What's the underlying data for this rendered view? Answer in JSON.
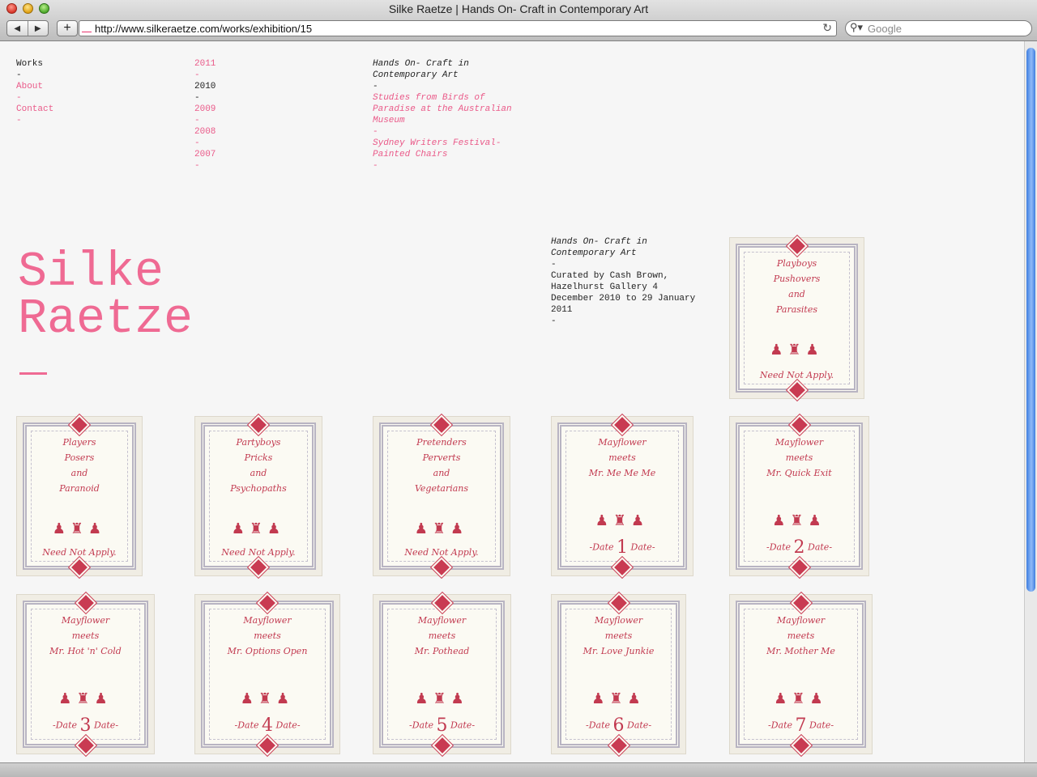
{
  "browser": {
    "title": "Silke Raetze | Hands On- Craft in Contemporary Art",
    "url": "http://www.silkeraetze.com/works/exhibition/15",
    "search_placeholder": "Google"
  },
  "nav": {
    "items": [
      {
        "label": "Works",
        "sep": "-"
      },
      {
        "label": "About",
        "sep": "-"
      },
      {
        "label": "Contact",
        "sep": "-"
      }
    ]
  },
  "years": {
    "items": [
      {
        "label": "2011",
        "sep": "-"
      },
      {
        "label": "2010",
        "sep": "-"
      },
      {
        "label": "2009",
        "sep": "-"
      },
      {
        "label": "2008",
        "sep": "-"
      },
      {
        "label": "2007",
        "sep": "-"
      }
    ]
  },
  "exhibitions": {
    "current": {
      "line1": "Hands On- Craft in",
      "line2": "Contemporary Art",
      "sep": "-"
    },
    "items": [
      {
        "lines": [
          "Studies from Birds of",
          "Paradise at the Australian",
          "Museum"
        ],
        "sep": "-"
      },
      {
        "lines": [
          "Sydney Writers Festival-",
          "Painted Chairs"
        ],
        "sep": "-"
      }
    ]
  },
  "logo": {
    "line1": "Silke",
    "line2": "Raetze"
  },
  "exhibition_info": {
    "title_line1": "Hands On- Craft in",
    "title_line2": "Contemporary Art",
    "sep1": "-",
    "desc": [
      "Curated by Cash Brown,",
      "Hazelhurst Gallery 4",
      "December 2010 to 29 January",
      "2011"
    ],
    "sep2": "-"
  },
  "colors": {
    "accent": "#ea5a89",
    "thread": "#c23a50",
    "text": "#222222"
  },
  "artworks": [
    {
      "lines": [
        "Playboys",
        "Pushovers",
        "and",
        "Parasites"
      ],
      "foot": "Need Not Apply."
    },
    {
      "lines": [
        "Players",
        "Posers",
        "and",
        "Paranoid"
      ],
      "foot": "Need Not Apply."
    },
    {
      "lines": [
        "Partyboys",
        "Pricks",
        "and",
        "Psychopaths"
      ],
      "foot": "Need Not Apply."
    },
    {
      "lines": [
        "Pretenders",
        "Perverts",
        "and",
        "Vegetarians"
      ],
      "foot": "Need Not Apply."
    },
    {
      "lines": [
        "Mayflower",
        "meets",
        "Mr. Me Me Me"
      ],
      "num": "1"
    },
    {
      "lines": [
        "Mayflower",
        "meets",
        "Mr. Quick Exit"
      ],
      "num": "2"
    },
    {
      "lines": [
        "Mayflower",
        "meets",
        "Mr. Hot 'n' Cold"
      ],
      "num": "3"
    },
    {
      "lines": [
        "Mayflower",
        "meets",
        "Mr. Options Open"
      ],
      "num": "4"
    },
    {
      "lines": [
        "Mayflower",
        "meets",
        "Mr. Pothead"
      ],
      "num": "5"
    },
    {
      "lines": [
        "Mayflower",
        "meets",
        "Mr. Love Junkie"
      ],
      "num": "6"
    },
    {
      "lines": [
        "Mayflower",
        "meets",
        "Mr. Mother Me"
      ],
      "num": "7"
    }
  ],
  "date_label": "Date"
}
